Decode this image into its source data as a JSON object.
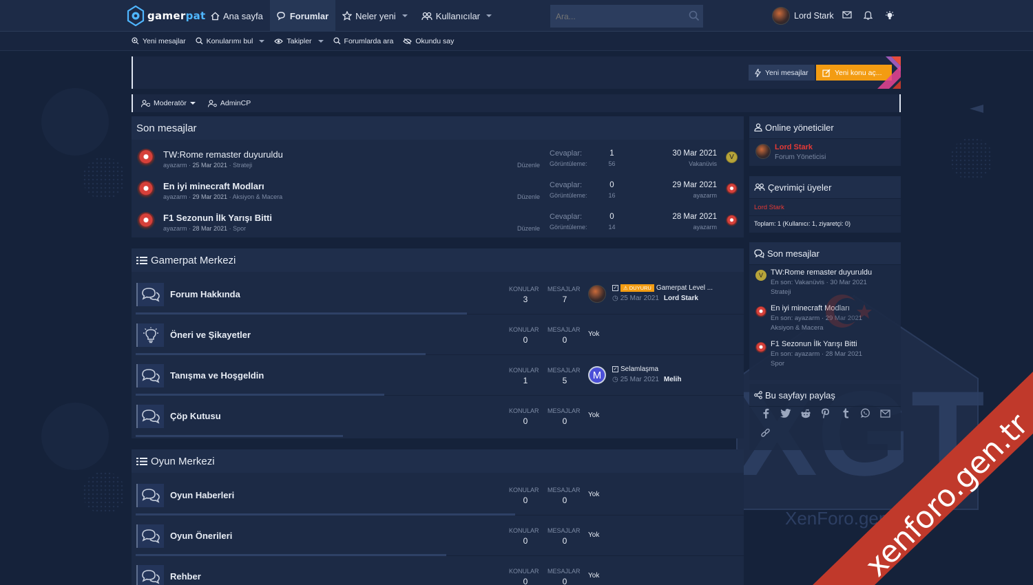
{
  "brand": {
    "logo_part1": "gamer",
    "logo_part2": "pat"
  },
  "nav": {
    "items": [
      {
        "label": "Ana sayfa",
        "icon": "home-icon"
      },
      {
        "label": "Forumlar",
        "icon": "comments-icon",
        "active": true
      },
      {
        "label": "Neler yeni",
        "icon": "star-icon",
        "dropdown": true
      },
      {
        "label": "Kullanıcılar",
        "icon": "users-icon",
        "dropdown": true
      }
    ]
  },
  "search": {
    "placeholder": "Ara..."
  },
  "user": {
    "name": "Lord Stark"
  },
  "subnav": {
    "items": [
      {
        "label": "Yeni mesajlar"
      },
      {
        "label": "Konularımı bul"
      },
      {
        "label": "Takipler"
      },
      {
        "label": "Forumlarda ara"
      },
      {
        "label": "Okundu say"
      }
    ]
  },
  "actions": {
    "new_messages": "Yeni mesajlar",
    "new_topic": "Yeni konu aç..."
  },
  "modbar": {
    "moderator": "Moderatör",
    "admincp": "AdminCP"
  },
  "recent": {
    "title": "Son mesajlar",
    "rows": [
      {
        "title": "TW:Rome remaster duyuruldu",
        "author": "ayazarm",
        "date": "25 Mar 2021",
        "forum": "Strateji",
        "edit": "Düzenle",
        "replies_label": "Cevaplar:",
        "views_label": "Görüntüleme:",
        "replies": "1",
        "views": "56",
        "last_date": "30 Mar 2021",
        "last_user": "Vakanüvis",
        "last_avatar": "V"
      },
      {
        "title": "En iyi minecraft Modları",
        "author": "ayazarm",
        "date": "29 Mar 2021",
        "forum": "Aksiyon & Macera",
        "edit": "Düzenle",
        "replies_label": "Cevaplar:",
        "views_label": "Görüntüleme:",
        "replies": "0",
        "views": "16",
        "last_date": "29 Mar 2021",
        "last_user": "ayazarm",
        "last_avatar": ""
      },
      {
        "title": "F1 Sezonun İlk Yarışı Bitti",
        "author": "ayazarm",
        "date": "28 Mar 2021",
        "forum": "Spor",
        "edit": "Düzenle",
        "replies_label": "Cevaplar:",
        "views_label": "Görüntüleme:",
        "replies": "0",
        "views": "14",
        "last_date": "28 Mar 2021",
        "last_user": "ayazarm",
        "last_avatar": ""
      }
    ]
  },
  "cat1": {
    "title": "Gamerpat Merkezi",
    "forums": [
      {
        "name": "Forum Hakkında",
        "icon": "comments-icon",
        "topics_label": "KONULAR",
        "msgs_label": "MESAJLAR",
        "topics": "3",
        "msgs": "7",
        "badge": "DUYURU",
        "last_title": "Gamerpat Level ...",
        "last_date": "25 Mar 2021",
        "last_user": "Lord Stark"
      },
      {
        "name": "Öneri ve Şikayetler",
        "icon": "lightbulb-icon",
        "topics_label": "KONULAR",
        "msgs_label": "MESAJLAR",
        "topics": "0",
        "msgs": "0",
        "none": "Yok"
      },
      {
        "name": "Tanışma ve Hoşgeldin",
        "icon": "comments-icon",
        "topics_label": "KONULAR",
        "msgs_label": "MESAJLAR",
        "topics": "1",
        "msgs": "5",
        "last_title": "Selamlaşma",
        "last_date": "25 Mar 2021",
        "last_user": "Melih",
        "last_avatar": "M"
      },
      {
        "name": "Çöp Kutusu",
        "icon": "comments-icon",
        "topics_label": "KONULAR",
        "msgs_label": "MESAJLAR",
        "topics": "0",
        "msgs": "0",
        "none": "Yok"
      }
    ]
  },
  "cat2": {
    "title": "Oyun Merkezi",
    "forums": [
      {
        "name": "Oyun Haberleri",
        "topics_label": "KONULAR",
        "msgs_label": "MESAJLAR",
        "topics": "0",
        "msgs": "0",
        "none": "Yok"
      },
      {
        "name": "Oyun Önerileri",
        "topics_label": "KONULAR",
        "msgs_label": "MESAJLAR",
        "topics": "0",
        "msgs": "0",
        "none": "Yok"
      },
      {
        "name": "Rehber",
        "topics_label": "KONULAR",
        "msgs_label": "MESAJLAR",
        "topics": "0",
        "msgs": "0",
        "none": "Yok"
      }
    ]
  },
  "sidebar": {
    "online_staff": {
      "title": "Online yöneticiler",
      "name": "Lord Stark",
      "role": "Forum Yöneticisi"
    },
    "online_members": {
      "title": "Çevrimiçi üyeler",
      "name": "Lord Stark",
      "total": "Toplam: 1 (Kullanıcı: 1, ziyaretçi: 0)"
    },
    "recent": {
      "title": "Son mesajlar",
      "items": [
        {
          "title": "TW:Rome remaster duyuruldu",
          "meta": "En son: Vakanüvis · 30 Mar 2021",
          "forum": "Strateji",
          "avatar": "V"
        },
        {
          "title": "En iyi minecraft Modları",
          "meta": "En son: ayazarm · 29 Mar 2021",
          "forum": "Aksiyon & Macera"
        },
        {
          "title": "F1 Sezonun İlk Yarışı Bitti",
          "meta": "En son: ayazarm · 28 Mar 2021",
          "forum": "Spor"
        }
      ]
    },
    "share": {
      "title": "Bu sayfayı paylaş"
    }
  },
  "watermark": {
    "text": "xenforo.gen.tr",
    "bg_text": "XenForo.gen.Tr",
    "bg_mark": "XGT"
  },
  "colors": {
    "accent": "#f39c12",
    "background": "#15223a",
    "panel": "#1c2a45",
    "ribbon": "#c0392b",
    "staff": "#e53935"
  }
}
